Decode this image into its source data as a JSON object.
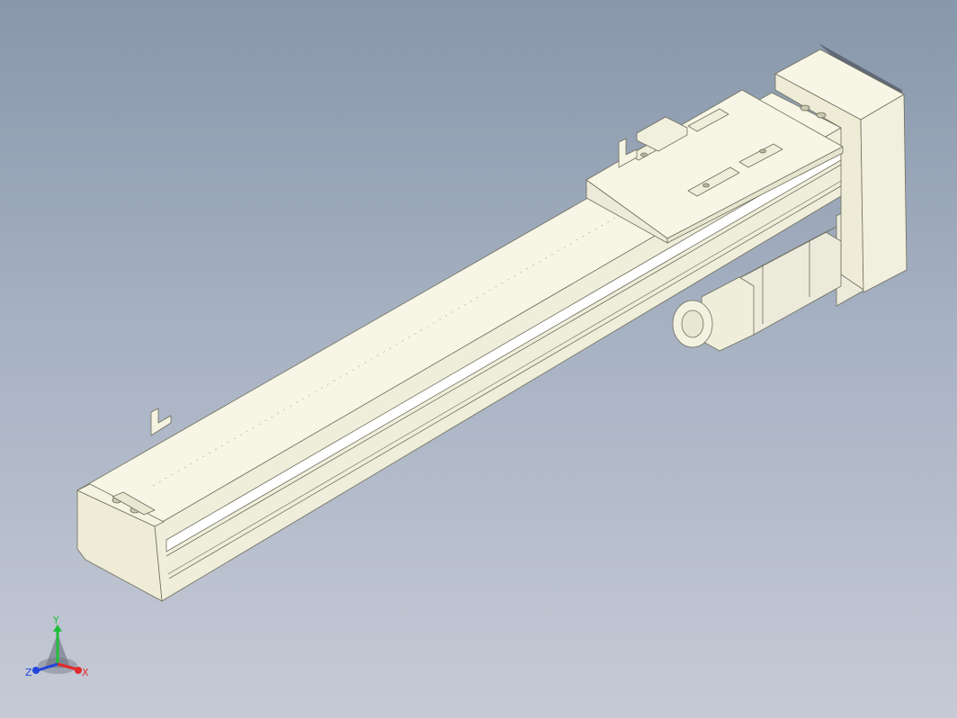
{
  "viewport": {
    "background_top": "#8897ab",
    "background_bottom": "#c6cad6",
    "model_color": "#f7f6e6",
    "model_shade": "#e6e5cf",
    "model_dark": "#d4d2b8",
    "edge_color": "#6f6e5c"
  },
  "triad": {
    "x_label": "X",
    "y_label": "Y",
    "z_label": "Z",
    "x_color": "#e22a2a",
    "y_color": "#1fbf3a",
    "z_color": "#2244dd"
  }
}
